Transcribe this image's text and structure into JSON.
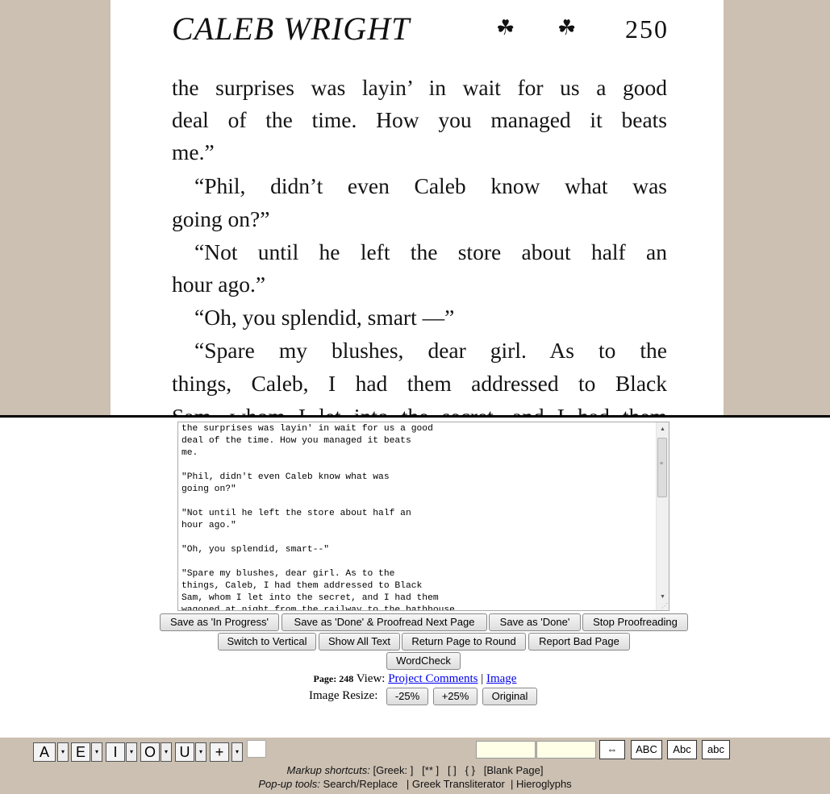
{
  "scan": {
    "title": "CALEB WRIGHT",
    "ornament": "☘",
    "page_number": "250",
    "lines": [
      "the surprises was layin’ in wait for us a good",
      "deal of the time.  How you managed it beats",
      "me.”",
      "“Phil, didn’t even  Caleb know what was",
      "going on?”",
      "“Not until he left the store about half an",
      "hour ago.”",
      "“Oh, you splendid, smart —”",
      "“Spare my blushes, dear girl.  As to the",
      "things, Caleb, I had them addressed to Black",
      "Sam, whom I let into the secret, and I had them"
    ]
  },
  "editor": {
    "text": "the surprises was layin' in wait for us a good\ndeal of the time. How you managed it beats\nme.\n\n\"Phil, didn't even Caleb know what was\ngoing on?\"\n\n\"Not until he left the store about half an\nhour ago.\"\n\n\"Oh, you splendid, smart--\"\n\n\"Spare my blushes, dear girl. As to the\nthings, Caleb, I had them addressed to Black\nSam, whom I let into the secret, and I had them\nwagoned at night from the railway to the bathhouse"
  },
  "buttons": {
    "save_in_progress": "Save as 'In Progress'",
    "save_done_next": "Save as 'Done' & Proofread Next Page",
    "save_done": "Save as 'Done'",
    "stop": "Stop Proofreading",
    "switch_vertical": "Switch to Vertical",
    "show_all": "Show All Text",
    "return_page": "Return Page to Round",
    "report_bad": "Report Bad Page",
    "wordcheck": "WordCheck"
  },
  "page_info": {
    "page_label": "Page: 248",
    "view_label": "View:",
    "project_comments": "Project Comments",
    "separator": "|",
    "image_link": "Image",
    "resize_label": "Image Resize:",
    "minus": "-25%",
    "plus": "+25%",
    "original": "Original"
  },
  "toolbar": {
    "chars": [
      "A",
      "E",
      "I",
      "O",
      "U",
      "+"
    ],
    "arrow": "▾",
    "swap_icon": "⇔",
    "case_upper": "ABC",
    "case_title": "Abc",
    "case_lower": "abc",
    "markup_label": "Markup shortcuts:",
    "markup_items": "[Greek: ]   [** ]   [ ]   { }   [Blank Page]",
    "popup_label": "Pop-up tools:",
    "popup_search": "Search/Replace",
    "popup_greek": "Greek Transliterator",
    "popup_hiero": "Hieroglyphs",
    "pipe": "|"
  }
}
